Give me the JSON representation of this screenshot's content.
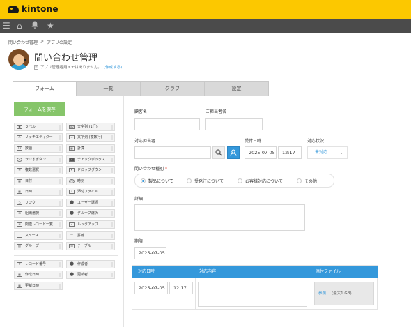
{
  "brand": {
    "name": "kintone"
  },
  "nav": {
    "menu_icon": "☰",
    "home_icon": "⌂",
    "bell_icon": "🔔",
    "star_icon": "★"
  },
  "breadcrumb": {
    "items": [
      "問い合わせ管理",
      "アプリの設定"
    ],
    "separator": ">"
  },
  "app": {
    "title": "問い合わせ管理",
    "memo_text": "アプリ管理者用メモはありません。",
    "memo_link": "(作成する)"
  },
  "tabs": [
    "フォーム",
    "一覧",
    "グラフ",
    "設定"
  ],
  "palette": {
    "save_label": "フォームを保存",
    "left_items": [
      "ラベル",
      "リッチエディター",
      "数値",
      "ラジオボタン",
      "複数選択",
      "日付",
      "日時",
      "リンク",
      "組織選択",
      "関連レコード一覧",
      "スペース",
      "グループ"
    ],
    "right_items": [
      "文字列 (1行)",
      "文字列 (複数行)",
      "計算",
      "チェックボックス",
      "ドロップダウン",
      "時刻",
      "添付ファイル",
      "ユーザー選択",
      "グループ選択",
      "ルックアップ",
      "罫線",
      "テーブル"
    ],
    "system_left": [
      "レコード番号",
      "作成日時",
      "更新日時"
    ],
    "system_right": [
      "作成者",
      "更新者"
    ]
  },
  "form": {
    "customer_label": "顧客名",
    "contact_label": "ご担当者名",
    "assignee_label": "対応担当者",
    "received_label": "受付日時",
    "received_date": "2025-07-05",
    "received_time": "12:17",
    "status_label": "対応状況",
    "status_value": "未対応",
    "kind_label": "問い合わせ種別",
    "kind_required": "*",
    "kind_options": [
      "製品について",
      "受発注について",
      "お客様対応について",
      "その他"
    ],
    "kind_selected": 0,
    "detail_label": "詳細",
    "deadline_label": "期限",
    "deadline_value": "2025-07-05"
  },
  "subtable": {
    "headers": [
      "対応日時",
      "対応内容",
      "添付ファイル"
    ],
    "date": "2025-07-05",
    "time": "12:17",
    "browse_label": "参照",
    "limit_label": "(最大1 GB)"
  },
  "colors": {
    "topbar": "#fcc800",
    "navbar": "#4b4b4b",
    "accent": "#3498db",
    "save": "#86c56a"
  }
}
